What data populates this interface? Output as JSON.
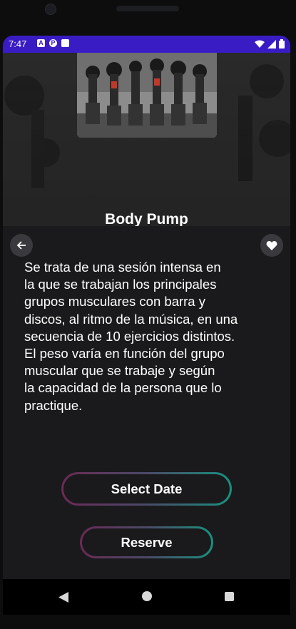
{
  "status_bar": {
    "time": "7:47",
    "icons": [
      "a-notification-icon",
      "p-notification-icon",
      "sim-card-icon",
      "wifi-icon",
      "signal-icon",
      "battery-icon"
    ]
  },
  "class_detail": {
    "title": "Body Pump",
    "description": "Se trata de una sesión intensa en\nla que se trabajan los principales\ngrupos musculares con barra y\ndiscos, al ritmo de la música, en una\nsecuencia de 10 ejercicios distintos.\nEl peso varía en función del grupo\nmuscular que se trabaje y según\nla capacidad de la persona que lo\npractique."
  },
  "actions": {
    "select_date_label": "Select Date",
    "reserve_label": "Reserve"
  },
  "colors": {
    "status_bar": "#3a1cc4",
    "background": "#1a1a1c",
    "gradient_start": "#6b2a55",
    "gradient_end": "#1a8f7e"
  }
}
